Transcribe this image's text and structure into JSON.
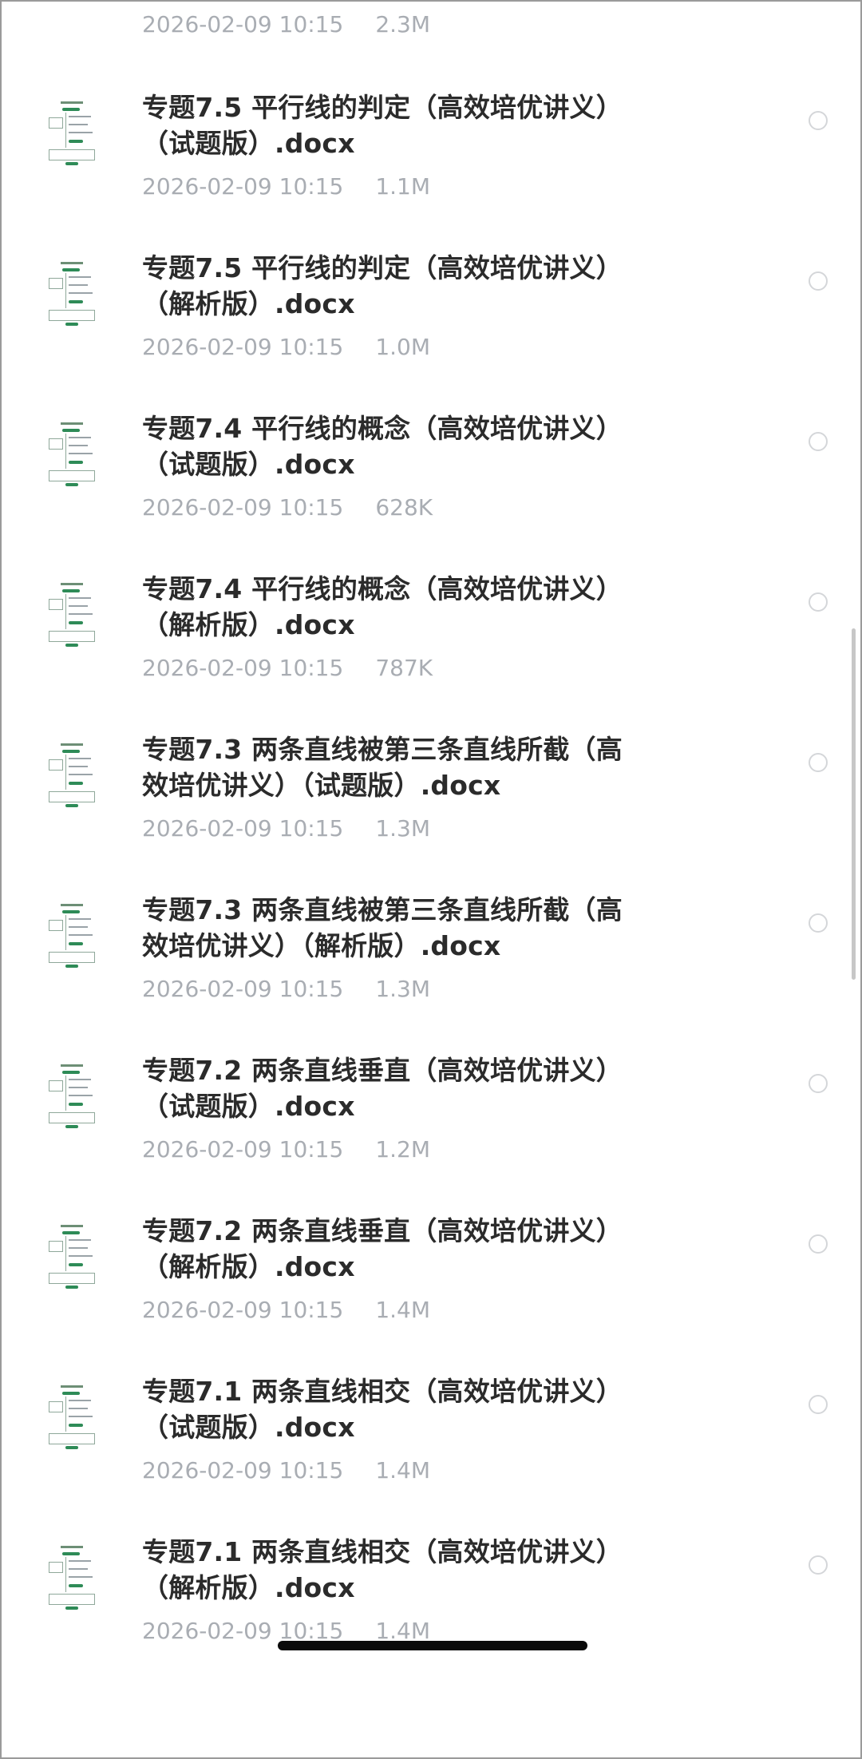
{
  "partial_item": {
    "date": "2026-02-09 10:15",
    "size": "2.3M"
  },
  "files": [
    {
      "line1": "专题7.5  平行线的判定（高效培优讲义）",
      "line2": "（试题版）.docx",
      "date": "2026-02-09 10:15",
      "size": "1.1M"
    },
    {
      "line1": "专题7.5  平行线的判定（高效培优讲义）",
      "line2": "（解析版）.docx",
      "date": "2026-02-09 10:15",
      "size": "1.0M"
    },
    {
      "line1": "专题7.4  平行线的概念（高效培优讲义）",
      "line2": "（试题版）.docx",
      "date": "2026-02-09 10:15",
      "size": "628K"
    },
    {
      "line1": "专题7.4  平行线的概念（高效培优讲义）",
      "line2": "（解析版）.docx",
      "date": "2026-02-09 10:15",
      "size": "787K"
    },
    {
      "line1": "专题7.3  两条直线被第三条直线所截（高",
      "line2": "效培优讲义）（试题版）.docx",
      "date": "2026-02-09 10:15",
      "size": "1.3M"
    },
    {
      "line1": "专题7.3  两条直线被第三条直线所截（高",
      "line2": "效培优讲义）（解析版）.docx",
      "date": "2026-02-09 10:15",
      "size": "1.3M"
    },
    {
      "line1": "专题7.2  两条直线垂直（高效培优讲义）",
      "line2": "（试题版）.docx",
      "date": "2026-02-09 10:15",
      "size": "1.2M"
    },
    {
      "line1": "专题7.2  两条直线垂直（高效培优讲义）",
      "line2": "（解析版）.docx",
      "date": "2026-02-09 10:15",
      "size": "1.4M"
    },
    {
      "line1": "专题7.1  两条直线相交（高效培优讲义）",
      "line2": "（试题版）.docx",
      "date": "2026-02-09 10:15",
      "size": "1.4M"
    },
    {
      "line1": "专题7.1  两条直线相交（高效培优讲义）",
      "line2": "（解析版）.docx",
      "date": "2026-02-09 10:15",
      "size": "1.4M"
    }
  ],
  "icons": {
    "thumbnail": "docx-thumbnail-icon",
    "select": "select-radio-icon"
  },
  "colors": {
    "title": "#2b2b2b",
    "meta": "#a9adb3",
    "radio_border": "#d4d6d9",
    "thumb_accent": "#2e8b57"
  }
}
